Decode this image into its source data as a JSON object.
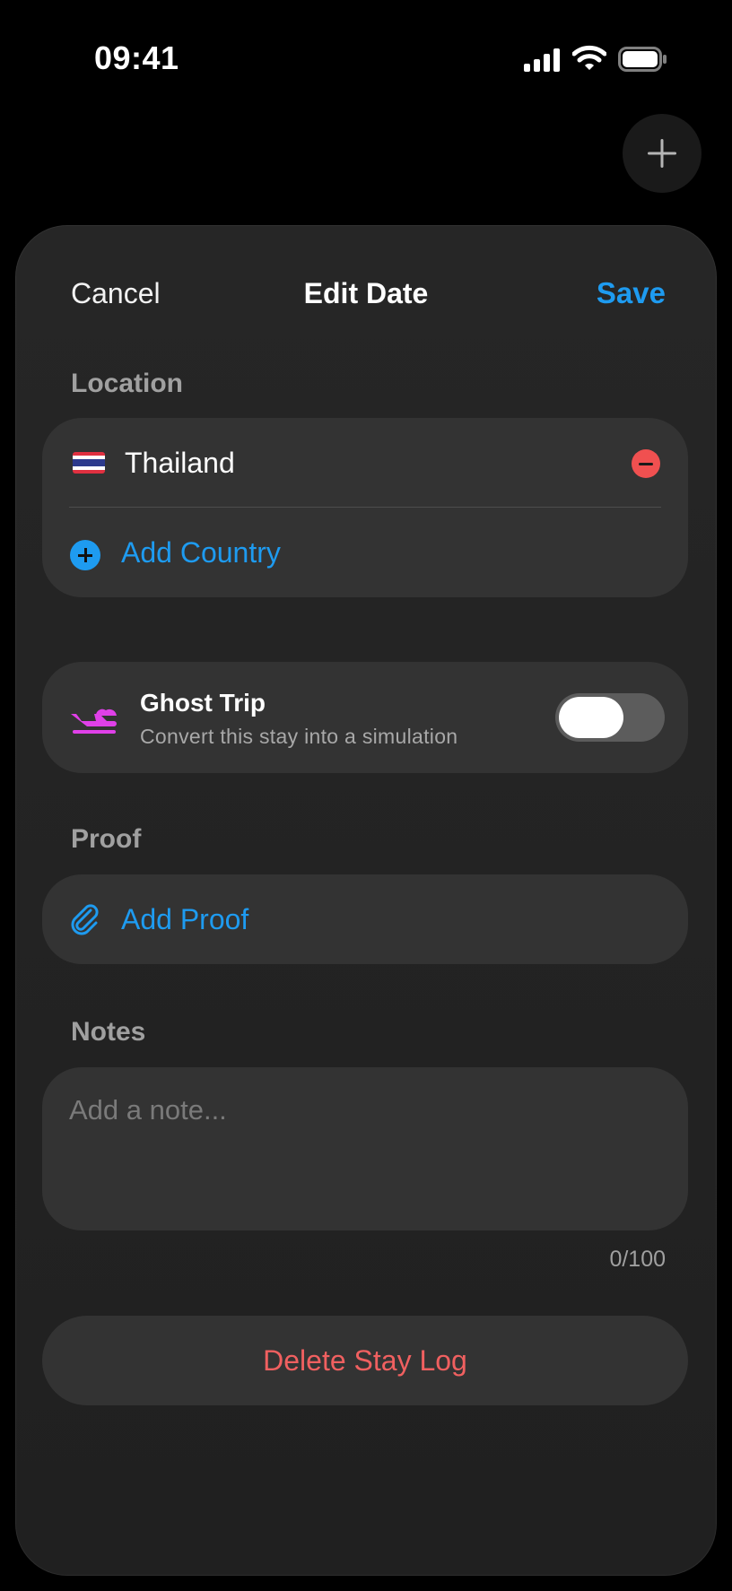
{
  "status_bar": {
    "time": "09:41"
  },
  "fab": {
    "icon": "plus-icon"
  },
  "nav": {
    "cancel_label": "Cancel",
    "title": "Edit Date",
    "save_label": "Save"
  },
  "location": {
    "label": "Location",
    "countries": [
      {
        "name": "Thailand",
        "flag": "thailand-flag"
      }
    ],
    "add_label": "Add Country"
  },
  "ghost_trip": {
    "title": "Ghost Trip",
    "subtitle": "Convert this stay into a simulation",
    "enabled": false
  },
  "proof": {
    "label": "Proof",
    "add_label": "Add Proof"
  },
  "notes": {
    "label": "Notes",
    "placeholder": "Add a note...",
    "counter": "0/100"
  },
  "delete_label": "Delete Stay Log",
  "colors": {
    "accent": "#1e9bf0",
    "destructive": "#f06060",
    "ghost": "#e040e8"
  }
}
